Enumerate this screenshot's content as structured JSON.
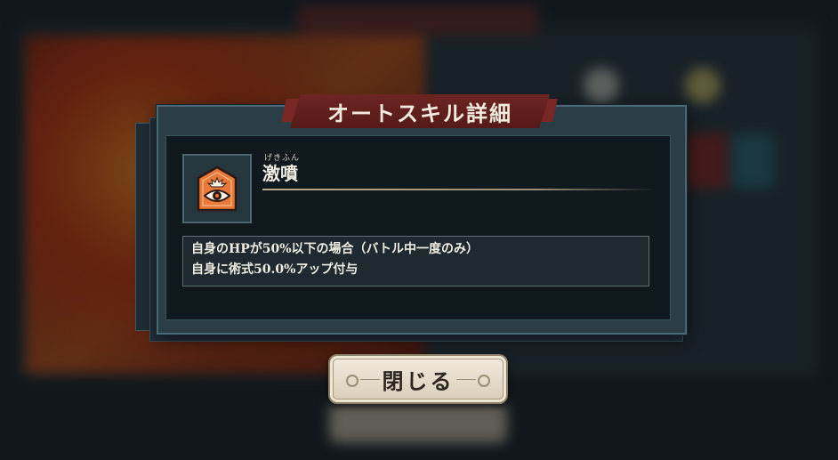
{
  "dialog": {
    "title": "オートスキル詳細",
    "skill": {
      "icon": "eye-burst-icon",
      "ruby": "げきふん",
      "name": "激噴",
      "description": [
        "自身のHPが50%以下の場合（バトル中一度のみ）",
        "自身に術式50.0%アップ付与"
      ]
    },
    "close_label": "閉じる"
  },
  "colors": {
    "banner": "#6d2522",
    "panel": "#2b3d47",
    "icon_bg": "#ea7a3b",
    "button": "#e8e0d0"
  }
}
